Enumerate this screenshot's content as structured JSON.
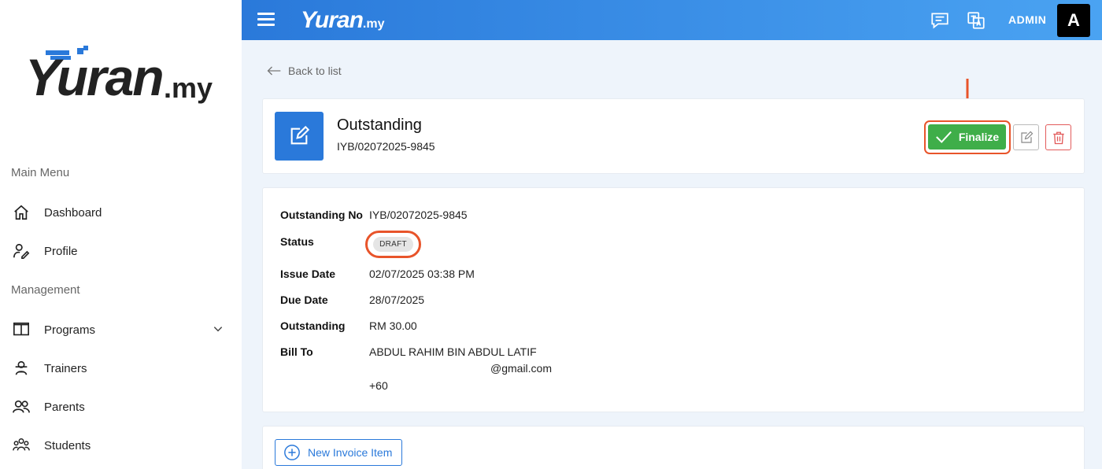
{
  "sidebar": {
    "logo": {
      "main": "Yuran",
      "suffix": ".my"
    },
    "sections": [
      {
        "label": "Main Menu"
      },
      {
        "label": "Management"
      }
    ],
    "items": [
      {
        "label": "Dashboard",
        "icon": "home-icon"
      },
      {
        "label": "Profile",
        "icon": "user-pen-icon"
      },
      {
        "label": "Programs",
        "icon": "book-open-icon"
      },
      {
        "label": "Trainers",
        "icon": "trainer-icon"
      },
      {
        "label": "Parents",
        "icon": "users-icon"
      },
      {
        "label": "Students",
        "icon": "students-icon"
      }
    ]
  },
  "topbar": {
    "logo": {
      "main": "Yuran",
      "suffix": ".my"
    },
    "user_label": "ADMIN",
    "avatar_initial": "A"
  },
  "main": {
    "back_label": "Back to list",
    "header": {
      "title": "Outstanding",
      "reference": "IYB/02072025-9845",
      "finalize_label": "Finalize"
    },
    "details": {
      "outstanding_no": {
        "label": "Outstanding No",
        "value": "IYB/02072025-9845"
      },
      "status": {
        "label": "Status",
        "value": "DRAFT"
      },
      "issue_date": {
        "label": "Issue Date",
        "value": "02/07/2025 03:38 PM"
      },
      "due_date": {
        "label": "Due Date",
        "value": "28/07/2025"
      },
      "outstanding": {
        "label": "Outstanding",
        "value": "RM 30.00"
      },
      "bill_to": {
        "label": "Bill To",
        "name": "ABDUL RAHIM BIN ABDUL LATIF",
        "email": "@gmail.com",
        "phone": "+60"
      }
    },
    "new_item_label": "New Invoice Item"
  },
  "colors": {
    "primary": "#2a79da",
    "success": "#3fae49",
    "danger": "#e25b5b",
    "annotation": "#e8542a"
  }
}
